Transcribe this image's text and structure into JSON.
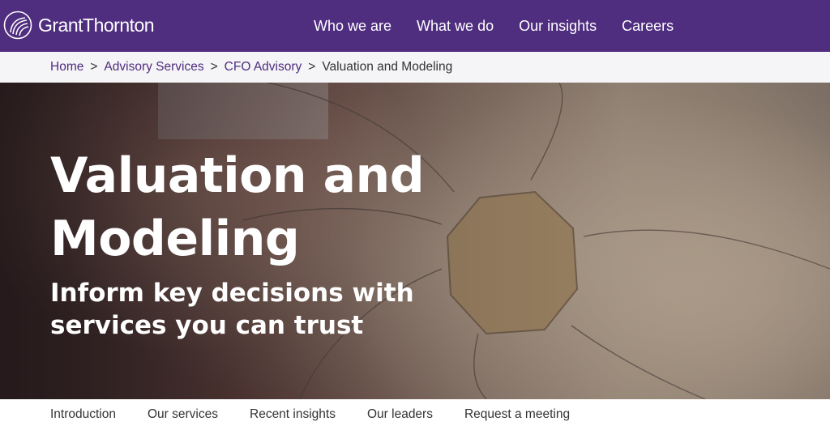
{
  "header": {
    "logo_text": "GrantThornton",
    "nav": [
      {
        "label": "Who we are"
      },
      {
        "label": "What we do"
      },
      {
        "label": "Our insights"
      },
      {
        "label": "Careers"
      }
    ]
  },
  "breadcrumb": {
    "items": [
      {
        "label": "Home"
      },
      {
        "label": "Advisory Services"
      },
      {
        "label": "CFO Advisory"
      }
    ],
    "separator": ">",
    "current": "Valuation and Modeling"
  },
  "hero": {
    "title": "Valuation and Modeling",
    "subtitle": "Inform key decisions with services you can trust"
  },
  "section_nav": {
    "items": [
      {
        "label": "Introduction"
      },
      {
        "label": "Our services"
      },
      {
        "label": "Recent insights"
      },
      {
        "label": "Our leaders"
      },
      {
        "label": "Request a meeting"
      }
    ]
  },
  "colors": {
    "brand_purple": "#4f2d7f",
    "breadcrumb_bg": "#f5f4f6",
    "text_dark": "#333333"
  },
  "icons": {
    "logo": "grant-thornton-logo-icon"
  }
}
